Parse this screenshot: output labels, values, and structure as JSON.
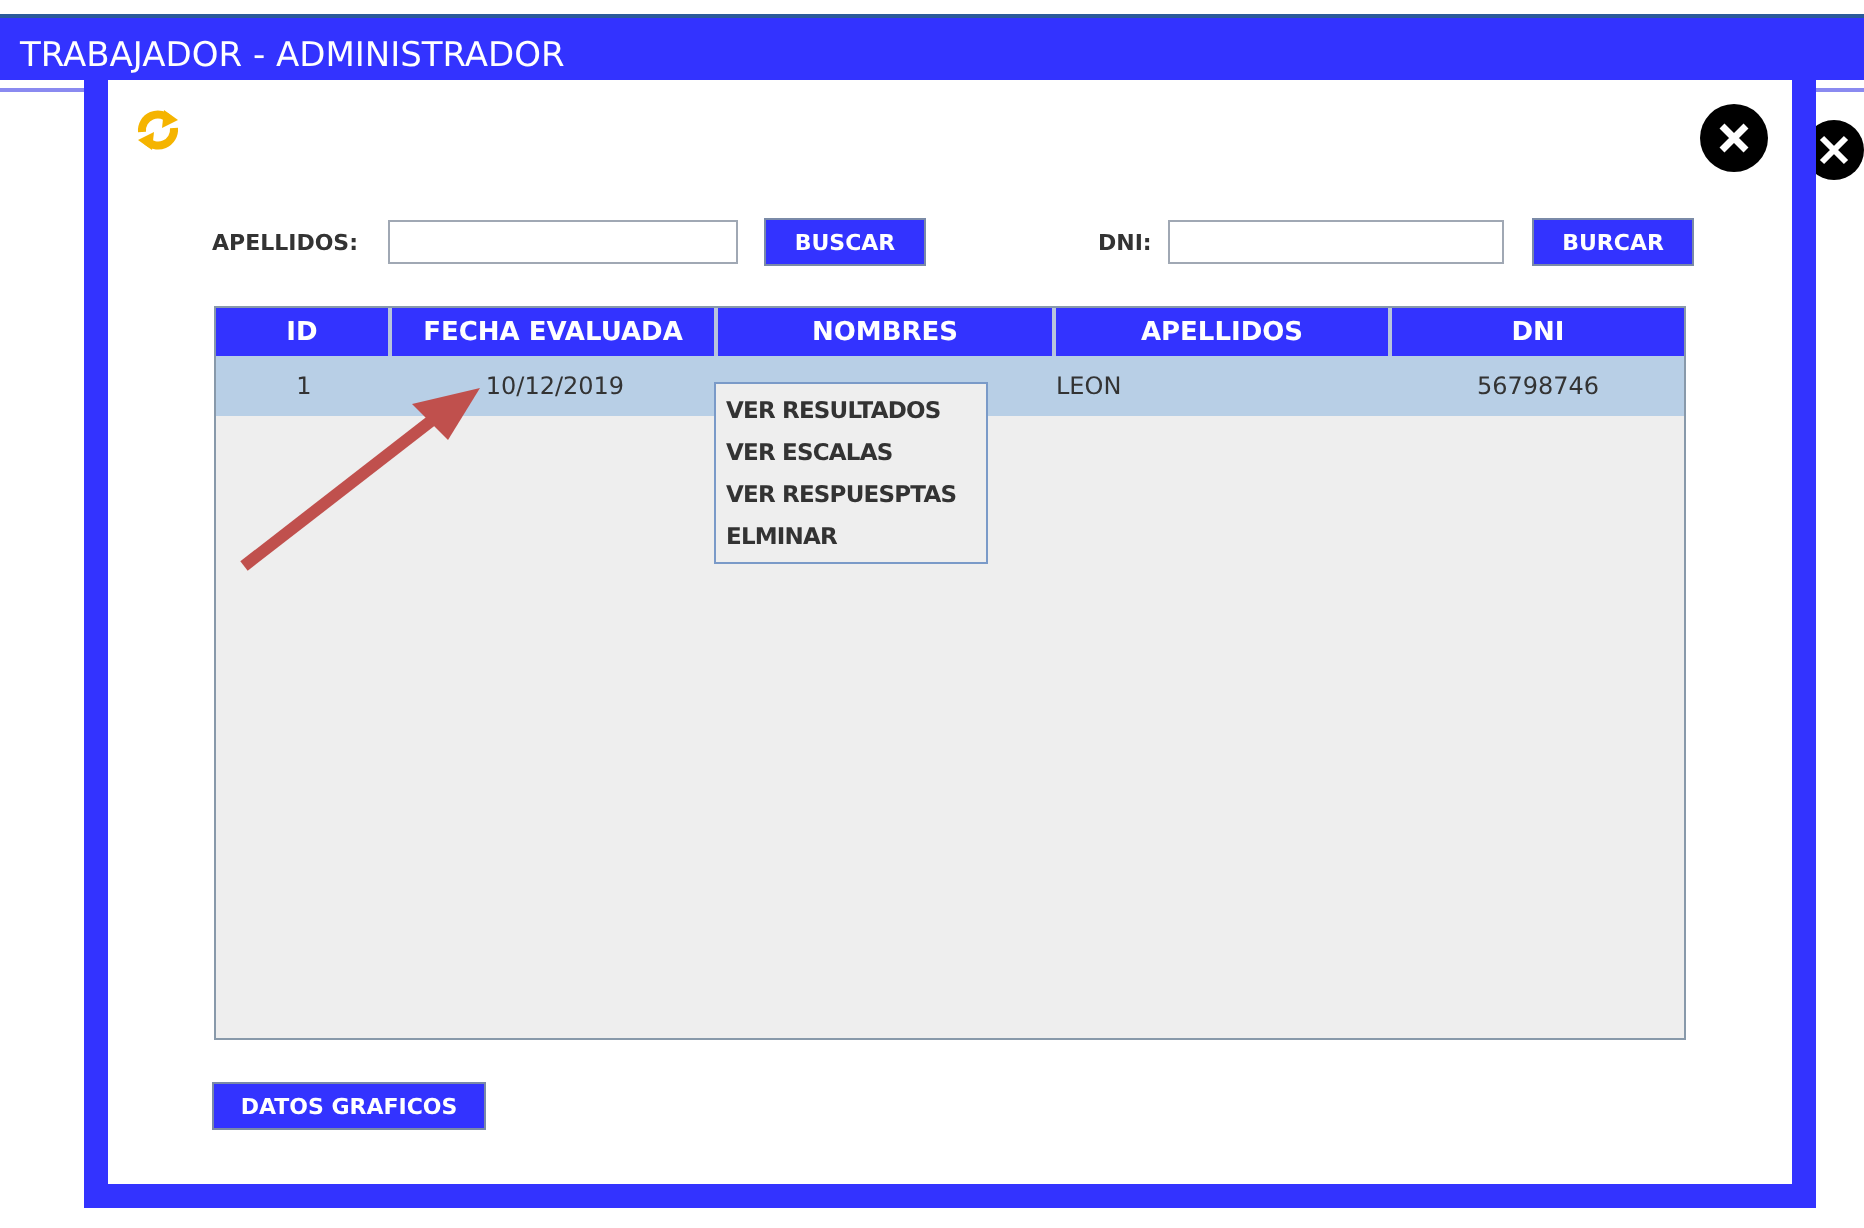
{
  "window": {
    "title": "TRABAJADOR - ADMINISTRADOR"
  },
  "search": [
    {
      "label": "APELLIDOS:",
      "button": "BUSCAR"
    },
    {
      "label": "DNI:",
      "button": "BURCAR"
    }
  ],
  "table": {
    "columns": [
      "ID",
      "FECHA EVALUADA",
      "NOMBRES",
      "APELLIDOS",
      "DNI"
    ],
    "rows": [
      {
        "selected": true,
        "cells": [
          "1",
          "10/12/2019",
          "",
          "LEON",
          "56798746"
        ]
      }
    ]
  },
  "context_menu": [
    "VER RESULTADOS",
    "VER ESCALAS",
    "VER RESPUESPTAS",
    "ELMINAR"
  ],
  "footer_button": "DATOS GRAFICOS"
}
